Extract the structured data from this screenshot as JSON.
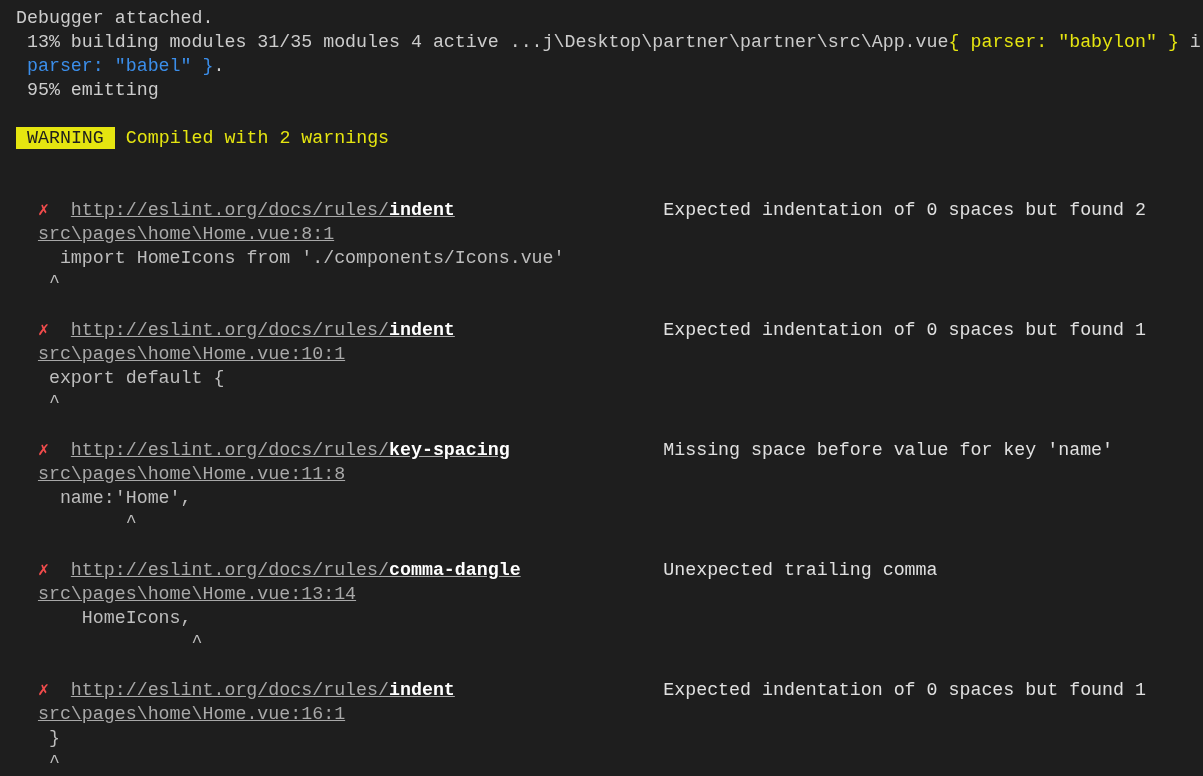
{
  "log_lines": [
    {
      "segments": [
        {
          "text": "Debugger attached.",
          "color": "#cccccc"
        }
      ]
    },
    {
      "segments": [
        {
          "text": " 13% building modules 31/35 modules 4 active ...j\\Desktop\\partner\\partner\\src\\App.vue",
          "color": "#cccccc"
        },
        {
          "text": "{ parser: \"babylon\" }",
          "color": "#e5e510"
        },
        {
          "text": " i",
          "color": "#cccccc"
        }
      ]
    },
    {
      "segments": [
        {
          "text": " parser: \"babel\" }",
          "color": "#3b8eea"
        },
        {
          "text": ".",
          "color": "#cccccc"
        }
      ]
    },
    {
      "segments": [
        {
          "text": " 95% emitting",
          "color": "#cccccc"
        }
      ]
    }
  ],
  "warning": {
    "badge": "WARNING",
    "message": "Compiled with 2 warnings"
  },
  "errors": [
    {
      "marker": "✗",
      "url_prefix": "http://eslint.org/docs/rules/",
      "rule": "indent",
      "message": "Expected indentation of 0 spaces but found 2",
      "location": "src\\pages\\home\\Home.vue:8:1",
      "code": "  import HomeIcons from './components/Icons.vue'",
      "caret": " ^"
    },
    {
      "marker": "✗",
      "url_prefix": "http://eslint.org/docs/rules/",
      "rule": "indent",
      "message": "Expected indentation of 0 spaces but found 1",
      "location": "src\\pages\\home\\Home.vue:10:1",
      "code": " export default {",
      "caret": " ^"
    },
    {
      "marker": "✗",
      "url_prefix": "http://eslint.org/docs/rules/",
      "rule": "key-spacing",
      "message": "Missing space before value for key 'name'",
      "location": "src\\pages\\home\\Home.vue:11:8",
      "code": "  name:'Home',",
      "caret": "        ^"
    },
    {
      "marker": "✗",
      "url_prefix": "http://eslint.org/docs/rules/",
      "rule": "comma-dangle",
      "message": "Unexpected trailing comma",
      "location": "src\\pages\\home\\Home.vue:13:14",
      "code": "    HomeIcons,",
      "caret": "              ^"
    },
    {
      "marker": "✗",
      "url_prefix": "http://eslint.org/docs/rules/",
      "rule": "indent",
      "message": "Expected indentation of 0 spaces but found 1",
      "location": "src\\pages\\home\\Home.vue:16:1",
      "code": " }",
      "caret": " ^"
    }
  ]
}
